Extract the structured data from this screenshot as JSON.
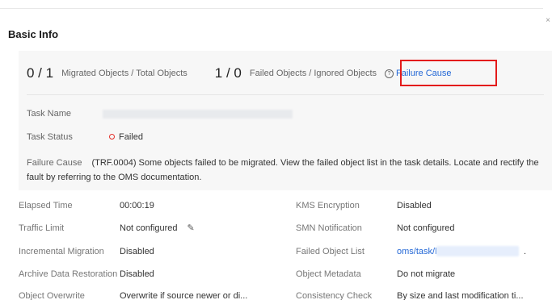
{
  "dialog": {
    "close_glyph": "×"
  },
  "section": {
    "title": "Basic Info"
  },
  "summary": {
    "migrated_count": "0 / 1",
    "migrated_label": "Migrated Objects / Total Objects",
    "failed_count": "1 / 0",
    "failed_label": "Failed Objects / Ignored Objects",
    "failure_cause_link": "Failure Cause",
    "task_name_label": "Task Name",
    "task_status_label": "Task Status",
    "task_status_value": "Failed",
    "failure_cause_label": "Failure Cause",
    "failure_cause_text": "(TRF.0004) Some objects failed to be migrated. View the failed object list in the task details. Locate and rectify the fault by referring to the OMS documentation."
  },
  "details": {
    "left": [
      {
        "label": "Elapsed Time",
        "value": "00:00:19"
      },
      {
        "label": "Traffic Limit",
        "value": "Not configured"
      },
      {
        "label": "Incremental Migration",
        "value": "Disabled"
      },
      {
        "label": "Archive Data Restoration",
        "value": "Disabled"
      },
      {
        "label": "Object Overwrite",
        "value": "Overwrite if source newer or di..."
      }
    ],
    "right": [
      {
        "label": "KMS Encryption",
        "value": "Disabled"
      },
      {
        "label": "SMN Notification",
        "value": "Not configured"
      },
      {
        "label": "Failed Object List",
        "value": "oms/task/l"
      },
      {
        "label": "Object Metadata",
        "value": "Do not migrate"
      },
      {
        "label": "Consistency Check",
        "value": "By size and last modification ti..."
      }
    ],
    "failed_list_suffix": "."
  },
  "colors": {
    "accent_link": "#2468d6",
    "status_failed": "#e4312b",
    "highlight": "#e31b1b"
  }
}
